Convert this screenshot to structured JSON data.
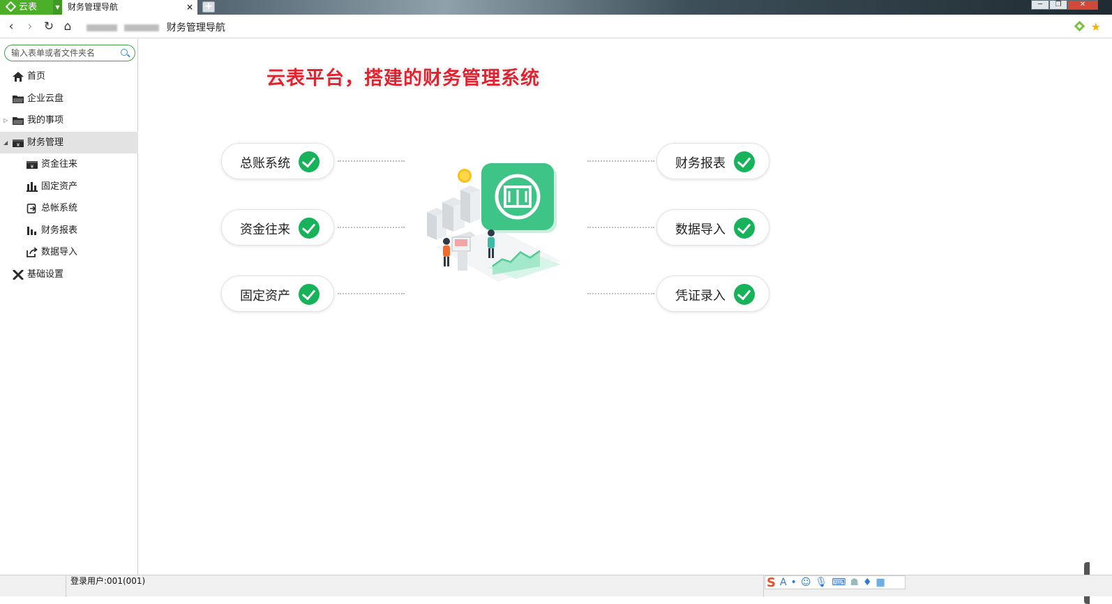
{
  "window": {
    "app_name": "云表",
    "active_tab": "财务管理导航",
    "tab_close": "×",
    "new_tab": "+"
  },
  "address": {
    "path": "财务管理导航"
  },
  "sidebar": {
    "search_placeholder": "输入表单或者文件夹名",
    "items": [
      {
        "label": "首页",
        "icon": "home-icon"
      },
      {
        "label": "企业云盘",
        "icon": "folder-icon"
      },
      {
        "label": "我的事项",
        "icon": "folder-icon"
      },
      {
        "label": "财务管理",
        "icon": "cashbox-icon",
        "active": true,
        "expanded": true
      },
      {
        "label": "资金往来",
        "icon": "cashbox-icon"
      },
      {
        "label": "固定资产",
        "icon": "building-icon"
      },
      {
        "label": "总帐系统",
        "icon": "ledger-icon"
      },
      {
        "label": "财务报表",
        "icon": "bar-chart-icon"
      },
      {
        "label": "数据导入",
        "icon": "export-icon"
      },
      {
        "label": "基础设置",
        "icon": "tools-icon"
      }
    ]
  },
  "content": {
    "headline": "云表平台，搭建的财务管理系统",
    "modules_left": [
      "总账系统",
      "资金往来",
      "固定资产"
    ],
    "modules_right": [
      "财务报表",
      "数据导入",
      "凭证录入"
    ],
    "accent_green": "#17b35a",
    "headline_red": "#e1232f"
  },
  "status": {
    "login_user": "登录用户:001(001)"
  }
}
